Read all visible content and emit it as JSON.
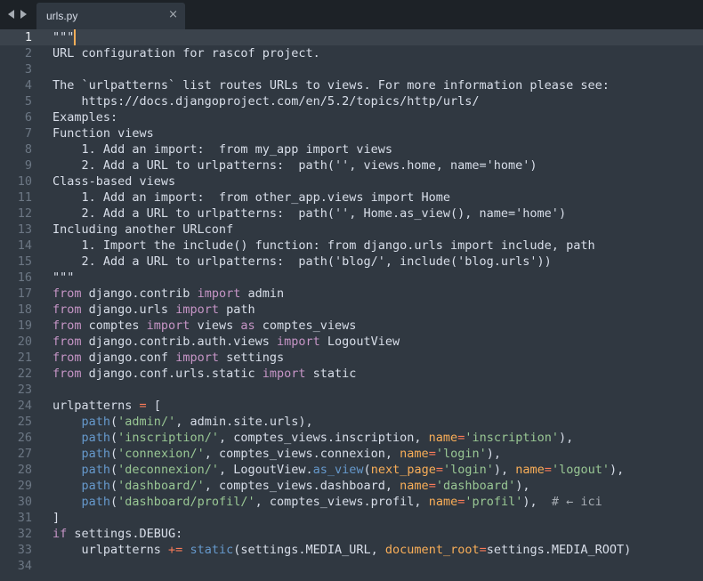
{
  "tabs": [
    {
      "label": "urls.py",
      "active": true,
      "close_glyph": "×"
    }
  ],
  "nav": {
    "back_icon": "arrow-left-icon",
    "forward_icon": "arrow-right-icon"
  },
  "editor": {
    "current_line": 1,
    "colors": {
      "background": "#303841",
      "text": "#d8dee9",
      "keyword": "#c695c6",
      "function": "#6699cc",
      "string": "#99c794",
      "parameter": "#f9ae58",
      "operator": "#f97b58",
      "comment": "#a6acb3"
    },
    "lines": [
      [
        [
          "plain",
          "\"\"\""
        ]
      ],
      [
        [
          "plain",
          "URL configuration for rascof project."
        ]
      ],
      [],
      [
        [
          "plain",
          "The `urlpatterns` list routes URLs to views. For more information please see:"
        ]
      ],
      [
        [
          "plain",
          "    https://docs.djangoproject.com/en/5.2/topics/http/urls/"
        ]
      ],
      [
        [
          "plain",
          "Examples:"
        ]
      ],
      [
        [
          "plain",
          "Function views"
        ]
      ],
      [
        [
          "plain",
          "    1. Add an import:  from my_app import views"
        ]
      ],
      [
        [
          "plain",
          "    2. Add a URL to urlpatterns:  path('', views.home, name='home')"
        ]
      ],
      [
        [
          "plain",
          "Class-based views"
        ]
      ],
      [
        [
          "plain",
          "    1. Add an import:  from other_app.views import Home"
        ]
      ],
      [
        [
          "plain",
          "    2. Add a URL to urlpatterns:  path('', Home.as_view(), name='home')"
        ]
      ],
      [
        [
          "plain",
          "Including another URLconf"
        ]
      ],
      [
        [
          "plain",
          "    1. Import the include() function: from django.urls import include, path"
        ]
      ],
      [
        [
          "plain",
          "    2. Add a URL to urlpatterns:  path('blog/', include('blog.urls'))"
        ]
      ],
      [
        [
          "plain",
          "\"\"\""
        ]
      ],
      [
        [
          "keyword",
          "from"
        ],
        [
          "plain",
          " django.contrib "
        ],
        [
          "keyword",
          "import"
        ],
        [
          "plain",
          " admin"
        ]
      ],
      [
        [
          "keyword",
          "from"
        ],
        [
          "plain",
          " django.urls "
        ],
        [
          "keyword",
          "import"
        ],
        [
          "plain",
          " path"
        ]
      ],
      [
        [
          "keyword",
          "from"
        ],
        [
          "plain",
          " comptes "
        ],
        [
          "keyword",
          "import"
        ],
        [
          "plain",
          " views "
        ],
        [
          "keyword",
          "as"
        ],
        [
          "plain",
          " comptes_views"
        ]
      ],
      [
        [
          "keyword",
          "from"
        ],
        [
          "plain",
          " django.contrib.auth.views "
        ],
        [
          "keyword",
          "import"
        ],
        [
          "plain",
          " LogoutView"
        ]
      ],
      [
        [
          "keyword",
          "from"
        ],
        [
          "plain",
          " django.conf "
        ],
        [
          "keyword",
          "import"
        ],
        [
          "plain",
          " settings"
        ]
      ],
      [
        [
          "keyword",
          "from"
        ],
        [
          "plain",
          " django.conf.urls.static "
        ],
        [
          "keyword",
          "import"
        ],
        [
          "plain",
          " static"
        ]
      ],
      [],
      [
        [
          "plain",
          "urlpatterns "
        ],
        [
          "op",
          "="
        ],
        [
          "plain",
          " ["
        ]
      ],
      [
        [
          "plain",
          "    "
        ],
        [
          "func",
          "path"
        ],
        [
          "plain",
          "("
        ],
        [
          "string",
          "'admin/'"
        ],
        [
          "plain",
          ", admin.site.urls),"
        ]
      ],
      [
        [
          "plain",
          "    "
        ],
        [
          "func",
          "path"
        ],
        [
          "plain",
          "("
        ],
        [
          "string",
          "'inscription/'"
        ],
        [
          "plain",
          ", comptes_views.inscription, "
        ],
        [
          "param",
          "name"
        ],
        [
          "op",
          "="
        ],
        [
          "string",
          "'inscription'"
        ],
        [
          "plain",
          "),"
        ]
      ],
      [
        [
          "plain",
          "    "
        ],
        [
          "func",
          "path"
        ],
        [
          "plain",
          "("
        ],
        [
          "string",
          "'connexion/'"
        ],
        [
          "plain",
          ", comptes_views.connexion, "
        ],
        [
          "param",
          "name"
        ],
        [
          "op",
          "="
        ],
        [
          "string",
          "'login'"
        ],
        [
          "plain",
          "),"
        ]
      ],
      [
        [
          "plain",
          "    "
        ],
        [
          "func",
          "path"
        ],
        [
          "plain",
          "("
        ],
        [
          "string",
          "'deconnexion/'"
        ],
        [
          "plain",
          ", LogoutView."
        ],
        [
          "func",
          "as_view"
        ],
        [
          "plain",
          "("
        ],
        [
          "param",
          "next_page"
        ],
        [
          "op",
          "="
        ],
        [
          "string",
          "'login'"
        ],
        [
          "plain",
          "), "
        ],
        [
          "param",
          "name"
        ],
        [
          "op",
          "="
        ],
        [
          "string",
          "'logout'"
        ],
        [
          "plain",
          "),"
        ]
      ],
      [
        [
          "plain",
          "    "
        ],
        [
          "func",
          "path"
        ],
        [
          "plain",
          "("
        ],
        [
          "string",
          "'dashboard/'"
        ],
        [
          "plain",
          ", comptes_views.dashboard, "
        ],
        [
          "param",
          "name"
        ],
        [
          "op",
          "="
        ],
        [
          "string",
          "'dashboard'"
        ],
        [
          "plain",
          "),"
        ]
      ],
      [
        [
          "plain",
          "    "
        ],
        [
          "func",
          "path"
        ],
        [
          "plain",
          "("
        ],
        [
          "string",
          "'dashboard/profil/'"
        ],
        [
          "plain",
          ", comptes_views.profil, "
        ],
        [
          "param",
          "name"
        ],
        [
          "op",
          "="
        ],
        [
          "string",
          "'profil'"
        ],
        [
          "plain",
          "),  "
        ],
        [
          "comment",
          "# ← ici"
        ]
      ],
      [
        [
          "plain",
          "]"
        ]
      ],
      [
        [
          "keyword",
          "if"
        ],
        [
          "plain",
          " settings.DEBUG:"
        ]
      ],
      [
        [
          "plain",
          "    urlpatterns "
        ],
        [
          "op",
          "+="
        ],
        [
          "plain",
          " "
        ],
        [
          "func",
          "static"
        ],
        [
          "plain",
          "(settings.MEDIA_URL, "
        ],
        [
          "param",
          "document_root"
        ],
        [
          "op",
          "="
        ],
        [
          "plain",
          "settings.MEDIA_ROOT)"
        ]
      ],
      []
    ]
  }
}
